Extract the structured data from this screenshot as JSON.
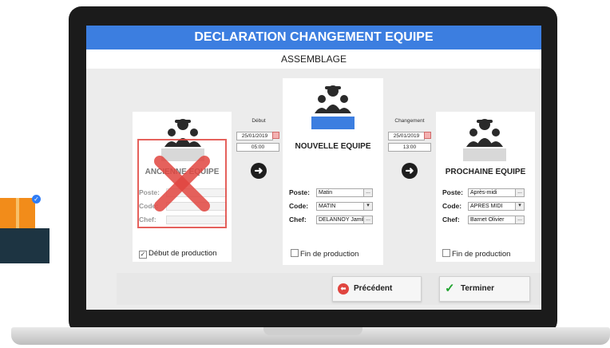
{
  "window": {
    "title": "DECLARATION CHANGEMENT EQUIPE",
    "subtitle": "ASSEMBLAGE"
  },
  "old_team": {
    "title": "ANCIENNE EQUIPE",
    "poste_label": "Poste:",
    "code_label": "Code:",
    "chef_label": "Chef:",
    "poste": "",
    "code": "",
    "chef": "",
    "checkbox_label": "Début de production",
    "checkbox_checked": true,
    "overlay_icon": "red-x-icon"
  },
  "start": {
    "label": "Début",
    "date": "25/01/2019",
    "time": "05:00"
  },
  "new_team": {
    "title": "NOUVELLE EQUIPE",
    "poste_label": "Poste:",
    "code_label": "Code:",
    "chef_label": "Chef:",
    "poste": "Matin",
    "code": "MATIN",
    "chef": "DELANNOY Jamil",
    "checkbox_label": "Fin de production",
    "checkbox_checked": false,
    "accent": "#3c7ee0"
  },
  "change": {
    "label": "Changement",
    "date": "25/01/2019",
    "time": "13:00"
  },
  "next_team": {
    "title": "PROCHAINE EQUIPE",
    "poste_label": "Poste:",
    "code_label": "Code:",
    "chef_label": "Chef:",
    "poste": "Après-midi",
    "code": "APRES MIDI",
    "chef": "Barnet Olivier",
    "checkbox_label": "Fin de production",
    "checkbox_checked": false
  },
  "buttons": {
    "previous": "Précédent",
    "finish": "Terminer"
  },
  "icons": {
    "ellipsis": "...",
    "dropdown": "▾",
    "check": "✓",
    "arrow_right": "➜",
    "arrow_left": "⬅"
  },
  "colors": {
    "title_bar": "#3c7ee0",
    "red": "#e0453f",
    "green": "#1fa32e"
  }
}
